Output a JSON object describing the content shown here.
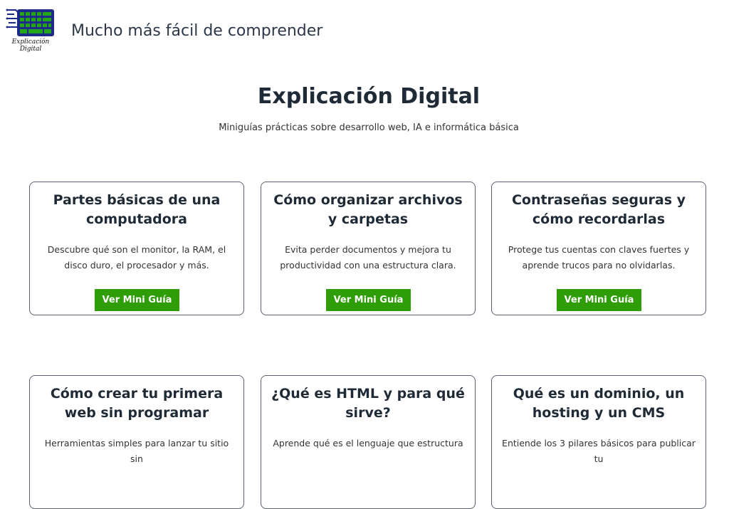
{
  "header": {
    "logo_text": [
      "Explicación",
      "Digital"
    ],
    "tagline": "Mucho más fácil de comprender"
  },
  "hero": {
    "title": "Explicación Digital",
    "subtitle": "Miniguías prácticas sobre desarrollo web, IA e informática básica"
  },
  "colors": {
    "button": "#2e9d08",
    "logo_blue": "#1e2a8a",
    "logo_green": "#25a51a"
  },
  "cards": [
    {
      "title": "Partes básicas de una computadora",
      "description": "Descubre qué son el monitor, la RAM, el disco duro, el procesador y más.",
      "button": "Ver Mini Guía"
    },
    {
      "title": "Cómo organizar archivos y carpetas",
      "description": "Evita perder documentos y mejora tu productividad con una estructura clara.",
      "button": "Ver Mini Guía"
    },
    {
      "title": "Contraseñas seguras y cómo recordarlas",
      "description": "Protege tus cuentas con claves fuertes y aprende trucos para no olvidarlas.",
      "button": "Ver Mini Guía"
    },
    {
      "title": "Cómo crear tu primera web sin programar",
      "description": "Herramientas simples para lanzar tu sitio sin",
      "button": ""
    },
    {
      "title": "¿Qué es HTML y para qué sirve?",
      "description": "Aprende qué es el lenguaje que estructura",
      "button": ""
    },
    {
      "title": "Qué es un dominio, un hosting y un CMS",
      "description": "Entiende los 3 pilares básicos para publicar tu",
      "button": ""
    }
  ]
}
